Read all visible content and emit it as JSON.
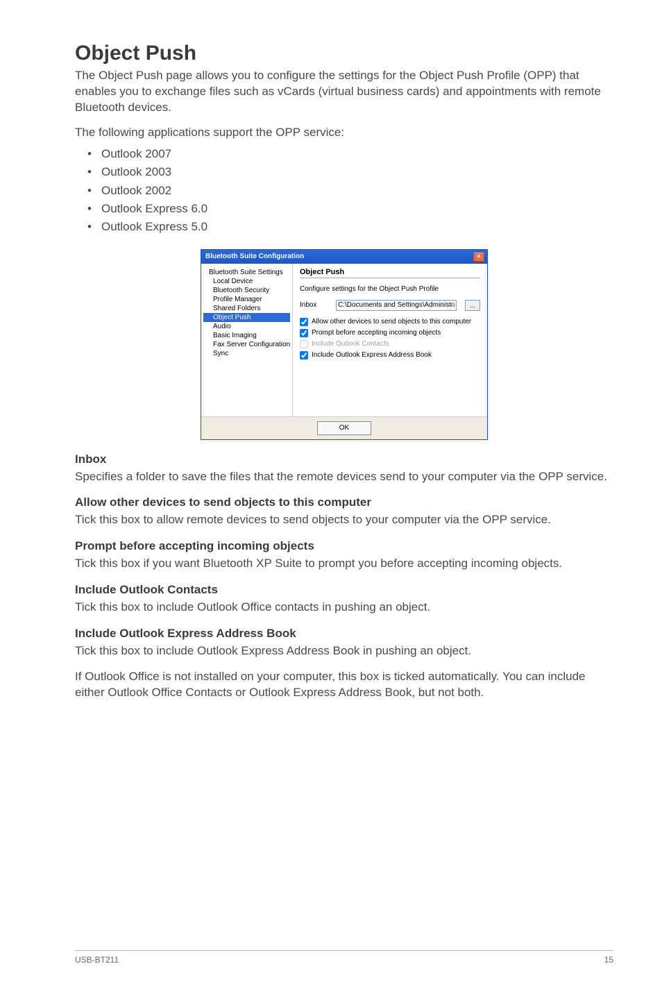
{
  "page": {
    "title": "Object Push",
    "intro": "The Object Push page allows you to configure the settings for the Object Push Profile (OPP) that enables you to exchange files such as vCards (virtual business cards) and appointments with remote Bluetooth devices.",
    "support_line": "The following applications support the OPP service:",
    "apps": [
      "Outlook 2007",
      "Outlook 2003",
      "Outlook 2002",
      "Outlook Express 6.0",
      "Outlook Express 5.0"
    ]
  },
  "sections": {
    "inbox": {
      "heading": "Inbox",
      "body": "Specifies a folder to save the files that the remote devices send to your computer via the OPP service."
    },
    "allow": {
      "heading": "Allow other devices to send objects to this computer",
      "body": "Tick this box to allow remote devices to send objects to your computer via the OPP service."
    },
    "prompt": {
      "heading": "Prompt before accepting incoming objects",
      "body": "Tick this box if you want Bluetooth XP Suite to prompt you before accepting incoming objects."
    },
    "contacts": {
      "heading": "Include Outlook Contacts",
      "body": "Tick this box to include Outlook Office contacts in pushing an object."
    },
    "express": {
      "heading": "Include Outlook Express Address Book",
      "body1": "Tick this box to include Outlook Express Address Book in pushing an object.",
      "body2": "If Outlook Office is not installed on your computer, this box is ticked automatically. You can include either Outlook Office Contacts or Outlook Express Address Book, but not both."
    }
  },
  "screenshot": {
    "window_title": "Bluetooth Suite Configuration",
    "tree": {
      "root": "Bluetooth Suite Settings",
      "items": [
        "Local Device",
        "Bluetooth Security",
        "Profile Manager",
        "Shared Folders",
        "Object Push",
        "Audio",
        "Basic Imaging",
        "Fax Server Configuration",
        "Sync"
      ],
      "selected_index": 4
    },
    "panel": {
      "title": "Object Push",
      "desc": "Configure settings for the Object Push Profile",
      "inbox_label": "Inbox",
      "inbox_value": "C:\\Documents and Settings\\Administrat",
      "browse_label": "...",
      "chk_allow": "Allow other devices to send objects to this computer",
      "chk_prompt": "Prompt before accepting incoming objects",
      "chk_contacts": "Include Outlook Contacts",
      "chk_express": "Include Outlook Express Address Book"
    },
    "ok_label": "OK"
  },
  "footer": {
    "product": "USB-BT211",
    "page_number": "15"
  }
}
